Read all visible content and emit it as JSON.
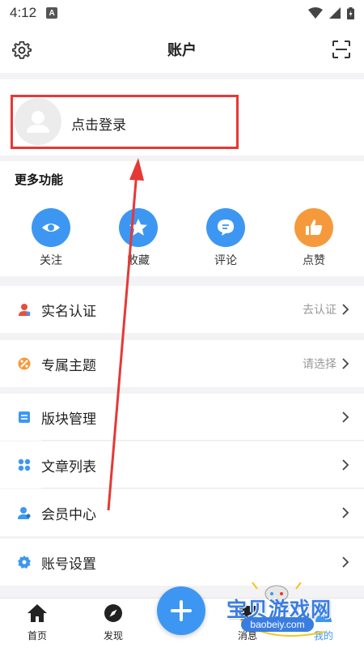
{
  "status_bar": {
    "time": "4:12",
    "badge": "A"
  },
  "header": {
    "title": "账户"
  },
  "login": {
    "text": "点击登录"
  },
  "features": {
    "title": "更多功能",
    "items": [
      {
        "label": "关注",
        "icon": "eye-icon",
        "color": "#3d97f2"
      },
      {
        "label": "收藏",
        "icon": "star-icon",
        "color": "#3d97f2"
      },
      {
        "label": "评论",
        "icon": "comment-icon",
        "color": "#3d97f2"
      },
      {
        "label": "点赞",
        "icon": "thumbs-up-icon",
        "color": "#f59a3c"
      }
    ]
  },
  "menu": {
    "realname": {
      "label": "实名认证",
      "value": "去认证"
    },
    "theme": {
      "label": "专属主题",
      "value": "请选择"
    },
    "board": {
      "label": "版块管理"
    },
    "articles": {
      "label": "文章列表"
    },
    "member": {
      "label": "会员中心"
    },
    "account": {
      "label": "账号设置"
    }
  },
  "bottom_nav": {
    "home": "首页",
    "discover": "发现",
    "messages": "消息",
    "mine": "我的"
  },
  "watermark": {
    "text": "宝贝游戏网",
    "url": "baobeiy.com"
  },
  "colors": {
    "accent": "#3d97f2",
    "highlight": "#e53935",
    "orange": "#f59a3c"
  }
}
